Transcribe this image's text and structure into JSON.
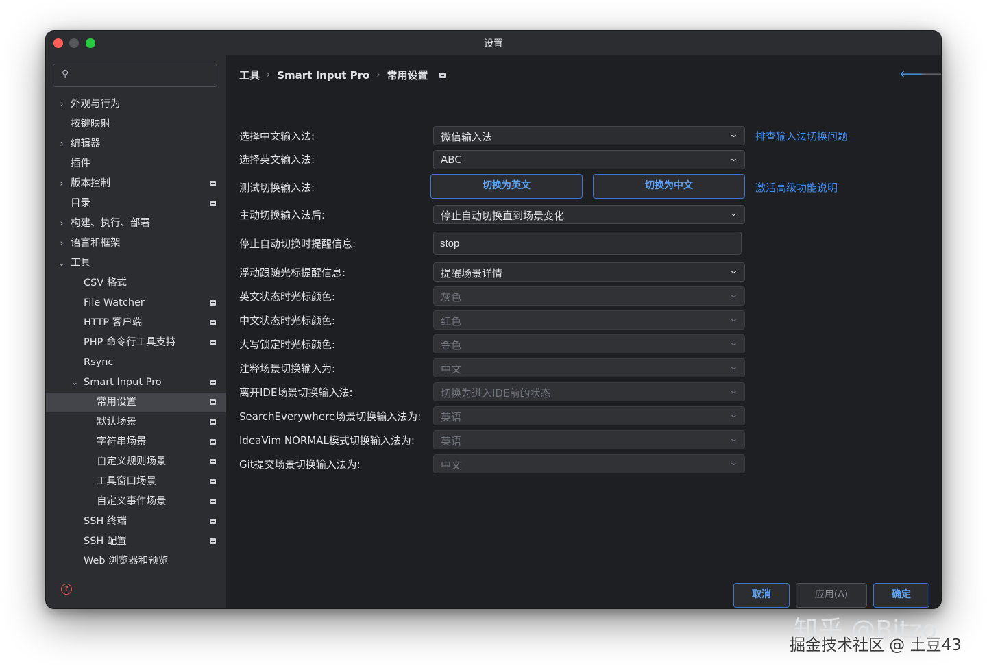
{
  "window": {
    "title": "设置"
  },
  "search": {
    "placeholder": "",
    "value": ""
  },
  "sidebar": {
    "items": [
      {
        "label": "外观与行为",
        "chevron": "›",
        "badge": false
      },
      {
        "label": "按键映射",
        "chevron": "",
        "badge": false
      },
      {
        "label": "编辑器",
        "chevron": "›",
        "badge": false
      },
      {
        "label": "插件",
        "chevron": "",
        "badge": false
      },
      {
        "label": "版本控制",
        "chevron": "›",
        "badge": true
      },
      {
        "label": "目录",
        "chevron": "",
        "badge": true
      },
      {
        "label": "构建、执行、部署",
        "chevron": "›",
        "badge": false
      },
      {
        "label": "语言和框架",
        "chevron": "›",
        "badge": false
      },
      {
        "label": "工具",
        "chevron": "⌄",
        "badge": false
      },
      {
        "label": "CSV 格式",
        "chevron": "",
        "badge": false
      },
      {
        "label": "File Watcher",
        "chevron": "",
        "badge": true
      },
      {
        "label": "HTTP 客户端",
        "chevron": "",
        "badge": true
      },
      {
        "label": "PHP 命令行工具支持",
        "chevron": "",
        "badge": true
      },
      {
        "label": "Rsync",
        "chevron": "",
        "badge": false
      },
      {
        "label": "Smart Input Pro",
        "chevron": "⌄",
        "badge": true
      },
      {
        "label": "常用设置",
        "chevron": "",
        "badge": true,
        "selected": true
      },
      {
        "label": "默认场景",
        "chevron": "",
        "badge": true
      },
      {
        "label": "字符串场景",
        "chevron": "",
        "badge": true
      },
      {
        "label": "自定义规则场景",
        "chevron": "",
        "badge": true
      },
      {
        "label": "工具窗口场景",
        "chevron": "",
        "badge": true
      },
      {
        "label": "自定义事件场景",
        "chevron": "",
        "badge": true
      },
      {
        "label": "SSH 终端",
        "chevron": "",
        "badge": true
      },
      {
        "label": "SSH 配置",
        "chevron": "",
        "badge": true
      },
      {
        "label": "Web 浏览器和预览",
        "chevron": "",
        "badge": false
      }
    ]
  },
  "breadcrumb": {
    "items": [
      "工具",
      "Smart Input Pro",
      "常用设置"
    ],
    "separator": "›"
  },
  "nav": {
    "back": "🡐",
    "forward": "🡒"
  },
  "form": {
    "cn_ime_label": "选择中文输入法:",
    "cn_ime_value": "微信输入法",
    "troubleshoot_link": "排查输入法切换问题",
    "en_ime_label": "选择英文输入法:",
    "en_ime_value": "ABC",
    "test_switch_label": "测试切换输入法:",
    "switch_en_button": "切换为英文",
    "switch_cn_button": "切换为中文",
    "activate_link": "激活高级功能说明",
    "manual_switch_label": "主动切换输入法后:",
    "manual_switch_value": "停止自动切换直到场景变化",
    "stop_msg_label": "停止自动切换时提醒信息:",
    "stop_msg_value": "stop",
    "float_label": "浮动跟随光标提醒信息:",
    "float_value": "提醒场景详情",
    "en_cursor_label": "英文状态时光标颜色:",
    "en_cursor_value": "灰色",
    "cn_cursor_label": "中文状态时光标颜色:",
    "cn_cursor_value": "红色",
    "caps_cursor_label": "大写锁定时光标颜色:",
    "caps_cursor_value": "金色",
    "comment_label": "注释场景切换输入为:",
    "comment_value": "中文",
    "leave_ide_label": "离开IDE场景切换输入法:",
    "leave_ide_value": "切换为进入IDE前的状态",
    "search_everywhere_label": "SearchEverywhere场景切换输入法为:",
    "search_everywhere_value": "英语",
    "ideavim_label": "IdeaVim NORMAL模式切换输入法为:",
    "ideavim_value": "英语",
    "git_label": "Git提交场景切换输入法为:",
    "git_value": "中文"
  },
  "footer": {
    "cancel": "取消",
    "apply": "应用(A)",
    "ok": "确定",
    "help": "?"
  },
  "watermark": {
    "line1": "知乎 @Bitzo",
    "line2": "掘金技术社区 @ 土豆43"
  },
  "colors": {
    "accent": "#3d8ef8",
    "panel": "#2b2d30",
    "content": "#1e1f22",
    "close": "#ff5f57",
    "zoom": "#28c840"
  },
  "icons": {
    "search": "search-icon",
    "help": "help-icon",
    "caret": "chevron-down-icon"
  }
}
